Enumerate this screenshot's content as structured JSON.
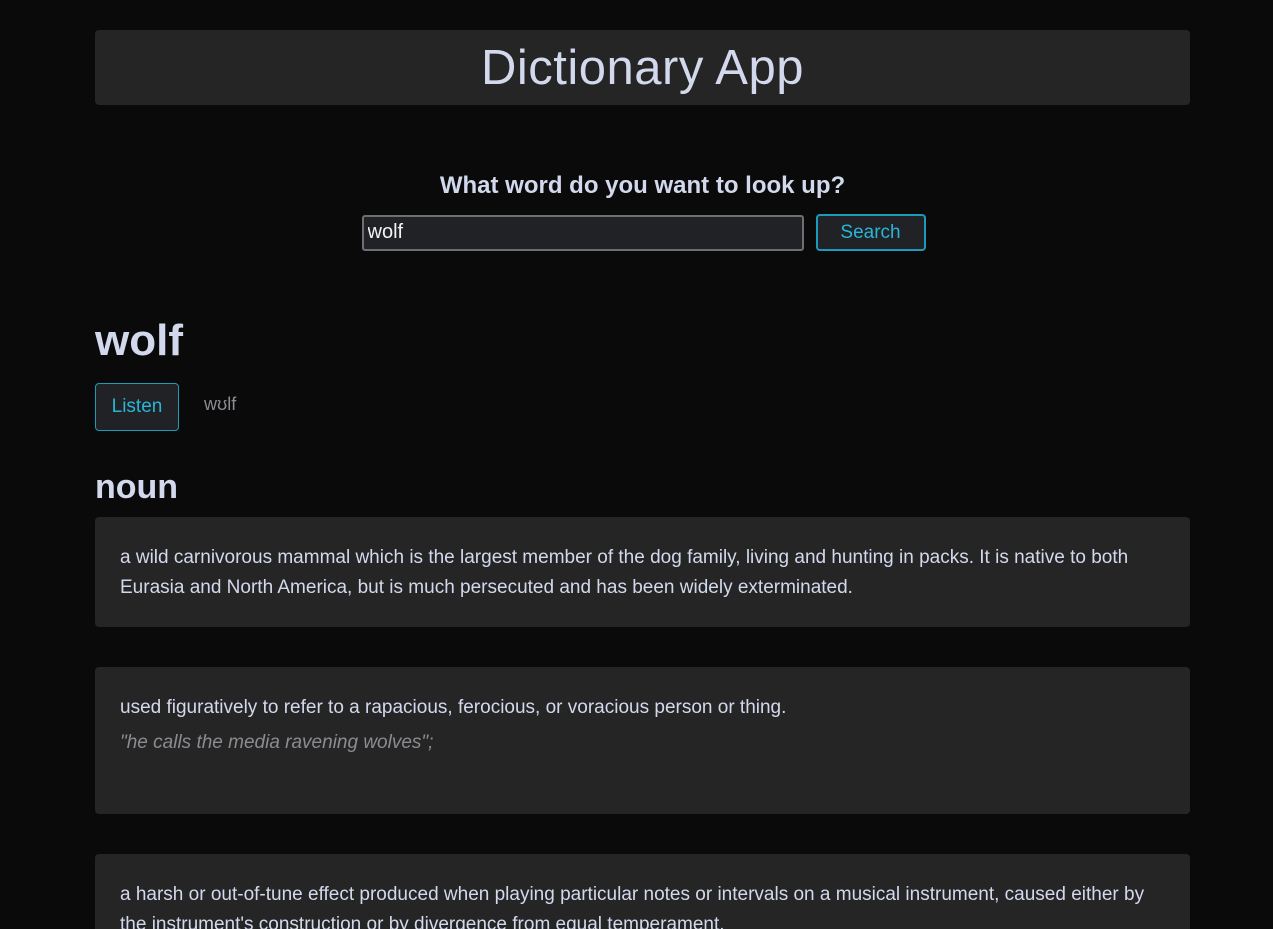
{
  "header": {
    "title": "Dictionary App"
  },
  "search": {
    "prompt": "What word do you want to look up?",
    "value": "wolf",
    "button_label": "Search"
  },
  "entry": {
    "word": "wolf",
    "listen_label": "Listen",
    "phonetic": "wʊlf",
    "part_of_speech": "noun",
    "definitions": [
      {
        "text": "a wild carnivorous mammal which is the largest member of the dog family, living and hunting in packs. It is native to both Eurasia and North America, but is much persecuted and has been widely exterminated.",
        "example": ""
      },
      {
        "text": "used figuratively to refer to a rapacious, ferocious, or voracious person or thing.",
        "example": "\"he calls the media ravening wolves\";"
      },
      {
        "text": "a harsh or out-of-tune effect produced when playing particular notes or intervals on a musical instrument, caused either by the instrument's construction or by divergence from equal temperament.",
        "example": ""
      }
    ]
  }
}
